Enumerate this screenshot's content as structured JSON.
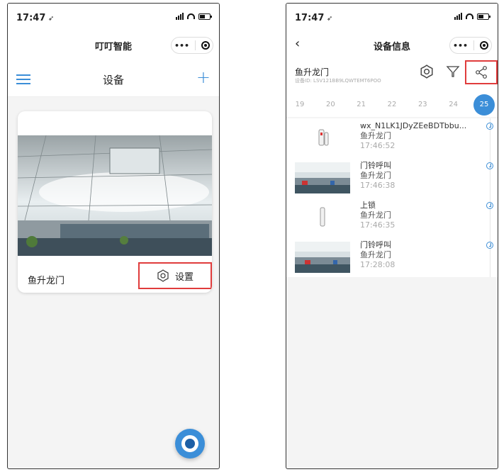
{
  "left": {
    "status_time": "17:47",
    "mini_title": "叮叮智能",
    "capsule_more": "•••",
    "page_title": "设备",
    "device_name": "鱼升龙门",
    "settings_label": "设置"
  },
  "right": {
    "status_time": "17:47",
    "nav_title": "设备信息",
    "capsule_more": "•••",
    "device_name": "鱼升龙门",
    "device_id": "设备ID: LSV121BB9LQWTEMT6POO",
    "days": [
      "19",
      "20",
      "21",
      "22",
      "23",
      "24",
      "25"
    ],
    "active_day": "25",
    "events": [
      {
        "title": "wx_N1LK1JDyZEeBDTbbu...",
        "device": "鱼升龙门",
        "time": "17:46:52",
        "thumb": "door-sensor"
      },
      {
        "title": "门铃呼叫",
        "device": "鱼升龙门",
        "time": "17:46:38",
        "thumb": "camera-snapshot"
      },
      {
        "title": "上锁",
        "device": "鱼升龙门",
        "time": "17:46:35",
        "thumb": "door-sensor"
      },
      {
        "title": "门铃呼叫",
        "device": "鱼升龙门",
        "time": "17:28:08",
        "thumb": "camera-snapshot"
      }
    ]
  },
  "colors": {
    "accent": "#3b8ed8",
    "highlight_box": "#e03c3c"
  }
}
